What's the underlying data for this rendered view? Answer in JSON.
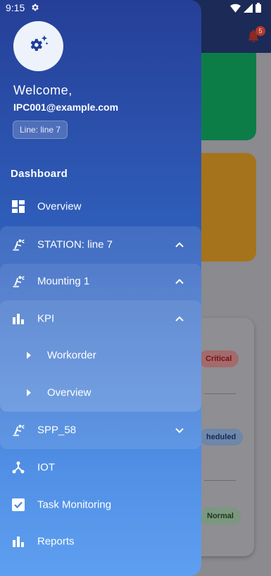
{
  "status_bar": {
    "time": "9:15"
  },
  "background": {
    "notification_count": "5",
    "pills": {
      "critical": "Critical",
      "scheduled": "heduled",
      "normal": "Normal"
    }
  },
  "drawer": {
    "welcome": "Welcome,",
    "email": "IPC001@example.com",
    "line_chip": "Line: line 7",
    "section_title": "Dashboard",
    "menu": {
      "overview": "Overview",
      "station": "STATION: line 7",
      "mounting": "Mounting 1",
      "kpi": "KPI",
      "workorder": "Workorder",
      "kpi_overview": "Overview",
      "spp": "SPP_58",
      "iot": "IOT",
      "task_monitoring": "Task Monitoring",
      "reports": "Reports"
    }
  },
  "colors": {
    "drawer_top": "#253f97",
    "drawer_bottom": "#5f9ff0",
    "critical": "#7b1010",
    "scheduled": "#102d5e",
    "normal": "#1a3b1e"
  },
  "icons": [
    "gear-icon",
    "wifi-icon",
    "signal-icon",
    "battery-icon",
    "bell-icon",
    "settings-avatar-icon",
    "dashboard-grid-icon",
    "robot-arm-icon",
    "bar-chart-icon",
    "triangle-right-icon",
    "chevron-up-icon",
    "chevron-down-icon",
    "hub-icon",
    "checkbox-icon"
  ]
}
